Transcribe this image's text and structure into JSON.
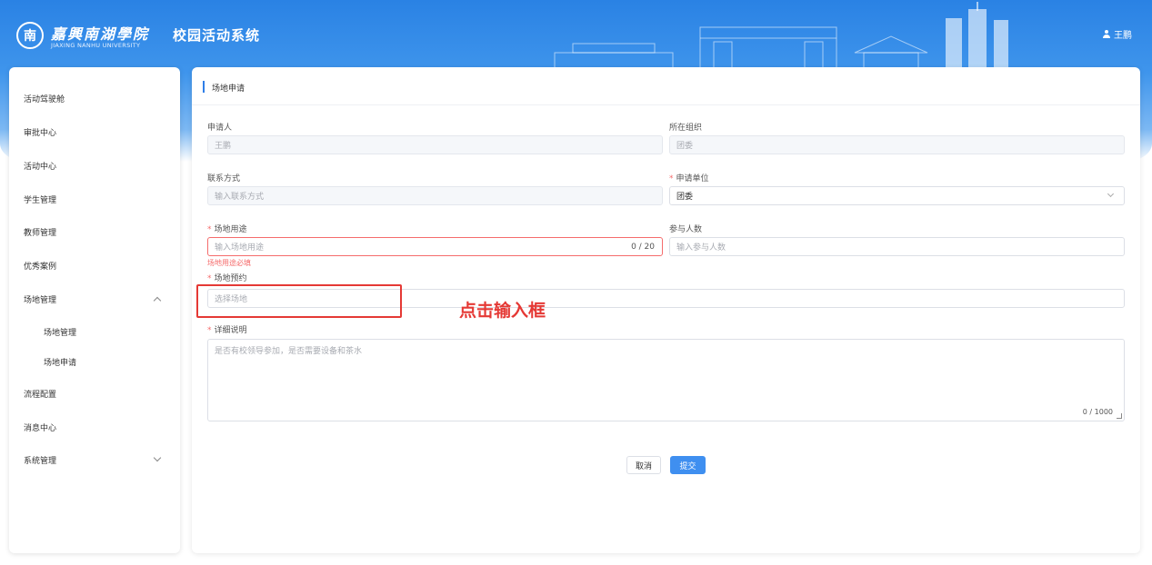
{
  "header": {
    "logo_mark": "南",
    "logo_cn": "嘉興南湖學院",
    "logo_en": "JIAXING NANHU UNIVERSITY",
    "app_title": "校园活动系统",
    "user_name": "王鹏"
  },
  "sidebar": {
    "items": [
      {
        "label": "活动驾驶舱"
      },
      {
        "label": "审批中心"
      },
      {
        "label": "活动中心"
      },
      {
        "label": "学生管理"
      },
      {
        "label": "教师管理"
      },
      {
        "label": "优秀案例"
      },
      {
        "label": "场地管理"
      },
      {
        "label": "场地管理"
      },
      {
        "label": "场地申请"
      },
      {
        "label": "流程配置"
      },
      {
        "label": "消息中心"
      },
      {
        "label": "系统管理"
      }
    ]
  },
  "panel": {
    "title": "场地申请"
  },
  "form": {
    "applicant": {
      "label": "申请人",
      "value": "王鹏"
    },
    "org": {
      "label": "所在组织",
      "value": "团委"
    },
    "contact": {
      "label": "联系方式",
      "placeholder": "输入联系方式"
    },
    "unit": {
      "label": "申请单位",
      "value": "团委"
    },
    "purpose": {
      "label": "场地用途",
      "placeholder": "输入场地用途",
      "count": "0 / 20",
      "error": "场地用途必填"
    },
    "participants": {
      "label": "参与人数",
      "placeholder": "输入参与人数"
    },
    "venue": {
      "label": "场地预约",
      "placeholder": "选择场地"
    },
    "details": {
      "label": "详细说明",
      "placeholder": "是否有校领导参加，是否需要设备和茶水",
      "count": "0 / 1000"
    }
  },
  "annotation": {
    "text": "点击输入框"
  },
  "actions": {
    "cancel": "取消",
    "submit": "提交"
  },
  "colors": {
    "primary": "#3f8ff0",
    "error": "#f56c6c",
    "header": "#2a82e4"
  }
}
